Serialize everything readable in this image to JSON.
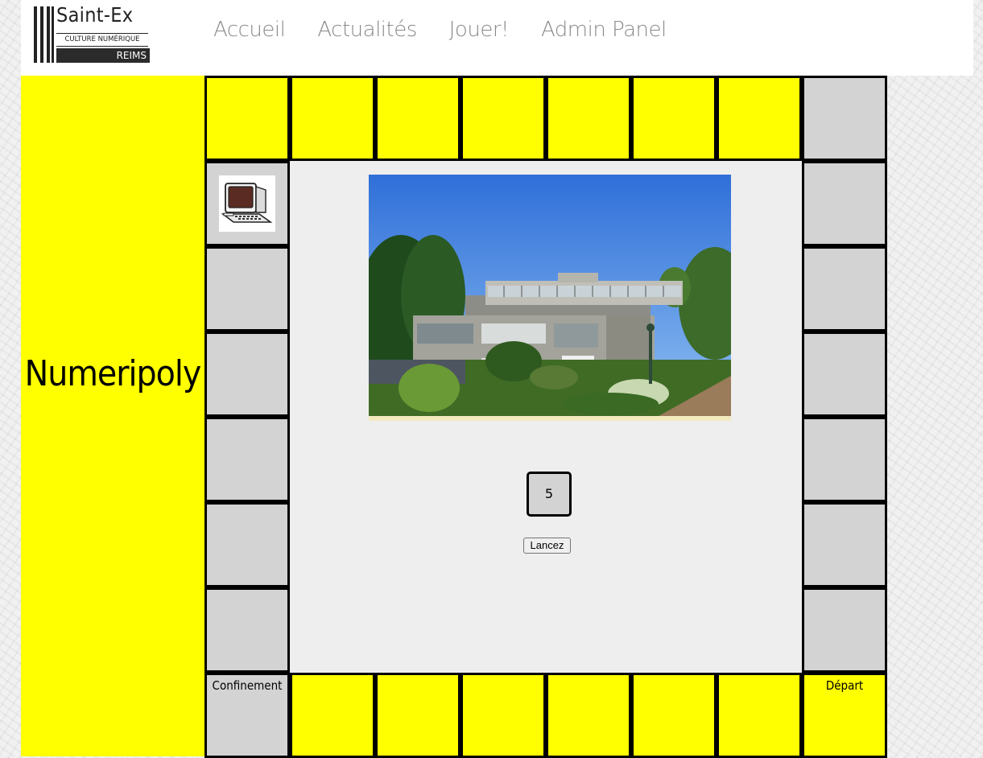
{
  "header": {
    "logo": {
      "title": "Saint-Ex",
      "subtitle": "CULTURE NUMÉRIQUE",
      "city": "REIMS"
    },
    "nav": [
      {
        "label": "Accueil"
      },
      {
        "label": "Actualités"
      },
      {
        "label": "Jouer!"
      },
      {
        "label": "Admin Panel"
      }
    ]
  },
  "sidebar": {
    "title": "Numeripoly"
  },
  "board": {
    "corners": {
      "jail_label": "Confinement",
      "start_label": "Départ"
    },
    "colors": {
      "property": "#ffff00",
      "neutral": "#d3d3d3",
      "border": "#000000"
    }
  },
  "center": {
    "photo_icon": "saint-ex-building-photo",
    "die_value": "5",
    "roll_button_label": "Lancez"
  },
  "player": {
    "icon": "computer-icon"
  }
}
